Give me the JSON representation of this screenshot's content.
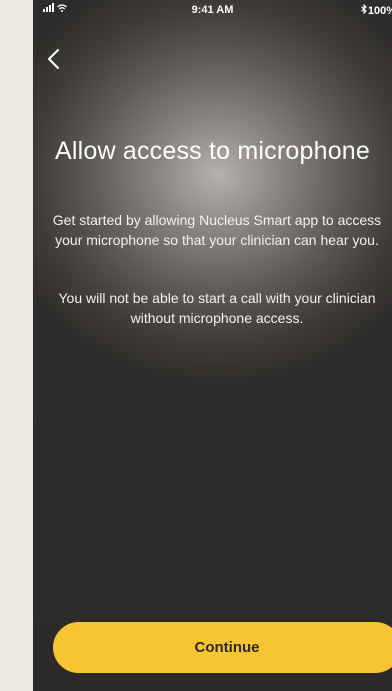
{
  "status_bar": {
    "time": "9:41 AM",
    "battery": "100%",
    "bluetooth_icon": "bluetooth-icon",
    "signal_icon": "cellular-signal-icon",
    "wifi_icon": "wifi-icon"
  },
  "header": {
    "back_icon": "chevron-left-icon"
  },
  "main": {
    "title": "Allow access to microphone",
    "paragraph_1": "Get started by allowing Nucleus Smart app to access your microphone so that your clinician can hear you.",
    "paragraph_2": "You will not be able to start a call with your clinician without microphone access."
  },
  "footer": {
    "continue_label": "Continue"
  },
  "colors": {
    "accent": "#f7c533",
    "page_background": "#ece8df",
    "screen_dark": "#2d2b29",
    "text": "#ffffff",
    "button_text": "#2b2b2b"
  }
}
